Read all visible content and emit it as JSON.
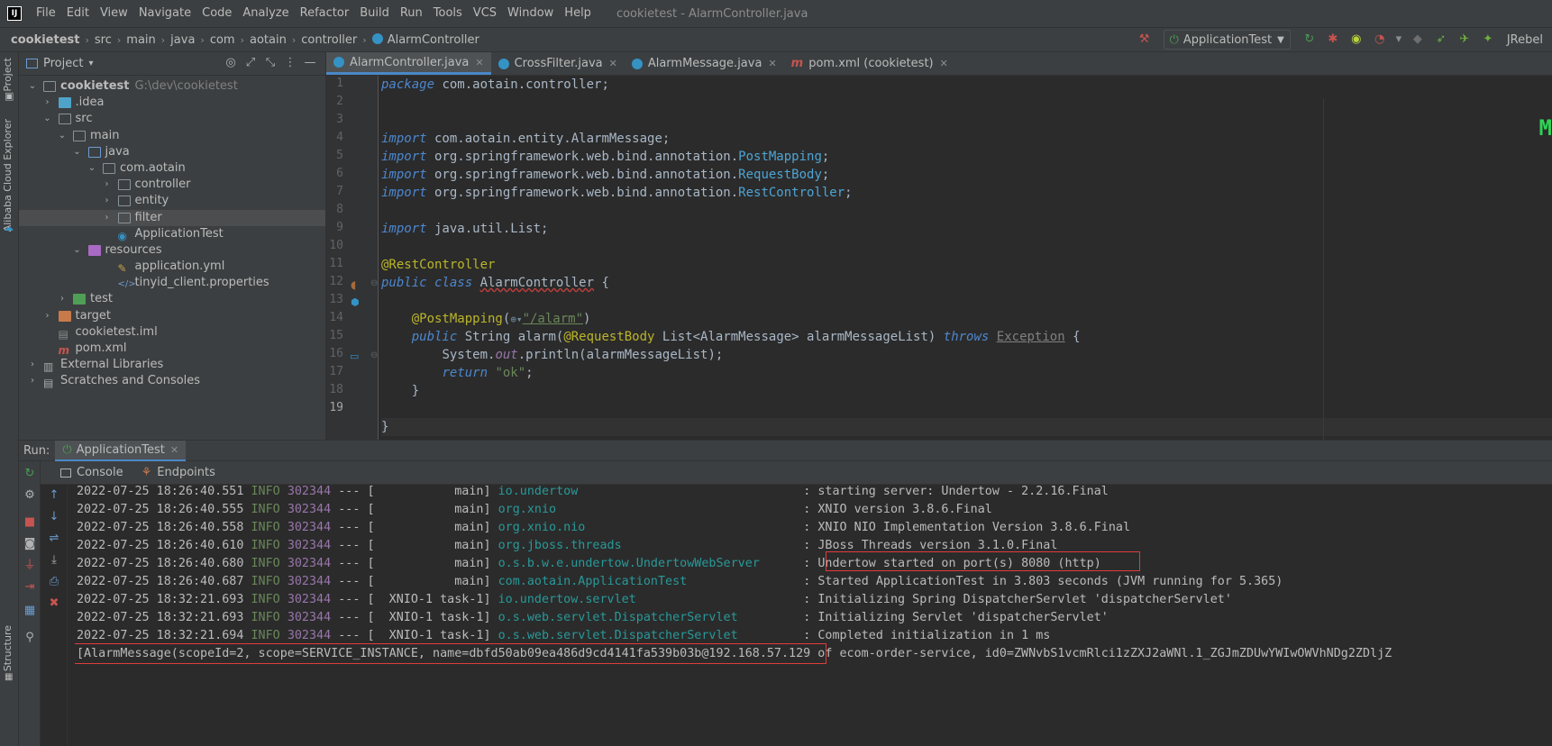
{
  "menu": {
    "items": [
      "File",
      "Edit",
      "View",
      "Navigate",
      "Code",
      "Analyze",
      "Refactor",
      "Build",
      "Run",
      "Tools",
      "VCS",
      "Window",
      "Help"
    ],
    "window_title": "cookietest - AlarmController.java"
  },
  "navbar": {
    "crumbs": [
      "cookietest",
      "src",
      "main",
      "java",
      "com",
      "aotain",
      "controller",
      "AlarmController"
    ],
    "run_config": "ApplicationTest",
    "jrebel": "JRebel"
  },
  "left_strip": {
    "project": "Project",
    "cloud": "Alibaba Cloud Explorer",
    "structure": "Structure"
  },
  "project": {
    "title": "Project",
    "tree": [
      {
        "label": "cookietest",
        "path": "G:\\dev\\cookietest",
        "depth": 0,
        "expanded": true,
        "icon": "folder"
      },
      {
        "label": ".idea",
        "depth": 1,
        "expanded": false,
        "icon": "folder-teal"
      },
      {
        "label": "src",
        "depth": 1,
        "expanded": true,
        "icon": "folder"
      },
      {
        "label": "main",
        "depth": 2,
        "expanded": true,
        "icon": "folder"
      },
      {
        "label": "java",
        "depth": 3,
        "expanded": true,
        "icon": "folder-blue"
      },
      {
        "label": "com.aotain",
        "depth": 4,
        "expanded": true,
        "icon": "folder"
      },
      {
        "label": "controller",
        "depth": 5,
        "expanded": false,
        "icon": "folder"
      },
      {
        "label": "entity",
        "depth": 5,
        "expanded": false,
        "icon": "folder"
      },
      {
        "label": "filter",
        "depth": 5,
        "expanded": false,
        "icon": "folder",
        "selected": true
      },
      {
        "label": "ApplicationTest",
        "depth": 5,
        "icon": "class"
      },
      {
        "label": "resources",
        "depth": 3,
        "expanded": true,
        "icon": "folder-purple"
      },
      {
        "label": "application.yml",
        "depth": 5,
        "icon": "yml"
      },
      {
        "label": "tinyid_client.properties",
        "depth": 5,
        "icon": "props"
      },
      {
        "label": "test",
        "depth": 2,
        "expanded": false,
        "icon": "folder-green"
      },
      {
        "label": "target",
        "depth": 1,
        "expanded": false,
        "icon": "folder-orange"
      },
      {
        "label": "cookietest.iml",
        "depth": 1,
        "icon": "iml"
      },
      {
        "label": "pom.xml",
        "depth": 1,
        "icon": "maven"
      },
      {
        "label": "External Libraries",
        "depth": 0,
        "expanded": false,
        "icon": "libs"
      },
      {
        "label": "Scratches and Consoles",
        "depth": 0,
        "expanded": false,
        "icon": "scratch"
      }
    ]
  },
  "editor": {
    "tabs": [
      {
        "label": "AlarmController.java",
        "active": true
      },
      {
        "label": "CrossFilter.java",
        "active": false
      },
      {
        "label": "AlarmMessage.java",
        "active": false
      },
      {
        "label": "pom.xml (cookietest)",
        "active": false
      }
    ],
    "lines": [
      "1",
      "2",
      "3",
      "4",
      "5",
      "6",
      "7",
      "8",
      "9",
      "10",
      "11",
      "12",
      "13",
      "14",
      "15",
      "16",
      "17",
      "18",
      "19"
    ],
    "code": {
      "l1_kw": "package",
      "l1_rest": " com.aotain.controller;",
      "l4_kw": "import",
      "l4_rest": " com.aotain.entity.AlarmMessage;",
      "l5_kw": "import",
      "l5_pkg": " org.springframework.web.bind.annotation.",
      "l5_cls": "PostMapping",
      "l5_end": ";",
      "l6_kw": "import",
      "l6_pkg": " org.springframework.web.bind.annotation.",
      "l6_cls": "RequestBody",
      "l6_end": ";",
      "l7_kw": "import",
      "l7_pkg": " org.springframework.web.bind.annotation.",
      "l7_cls": "RestController",
      "l7_end": ";",
      "l9_kw": "import",
      "l9_rest": " java.util.List;",
      "l11_ann": "@RestController",
      "l12_kw": "public class ",
      "l12_cls": "AlarmController",
      "l12_end": " {",
      "l14_ann": "@PostMapping",
      "l14_open": "(",
      "l14_str": "\"/alarm\"",
      "l14_close": ")",
      "l15_kw": "public ",
      "l15_a": "String alarm(",
      "l15_ann": "@RequestBody",
      "l15_b": " List<AlarmMessage> alarmMessageList) ",
      "l15_kw2": "throws ",
      "l15_exc": "Exception",
      "l15_end": " {",
      "l16_a": "System.",
      "l16_fld": "out",
      "l16_b": ".println(alarmMessageList);",
      "l17_kw": "return ",
      "l17_str": "\"ok\"",
      "l17_end": ";",
      "l18": "}",
      "l19": "}"
    },
    "deco_text": "M"
  },
  "run": {
    "label": "Run:",
    "tab": "ApplicationTest",
    "subtabs": [
      "Console",
      "Endpoints"
    ],
    "logs": [
      {
        "ts": "2022-07-25 18:26:40.551",
        "lv": "INFO",
        "pid": "302344",
        "sep": "---",
        "thread": "[           main]",
        "logger": "io.undertow                              ",
        "msg": ": starting server: Undertow - 2.2.16.Final"
      },
      {
        "ts": "2022-07-25 18:26:40.555",
        "lv": "INFO",
        "pid": "302344",
        "sep": "---",
        "thread": "[           main]",
        "logger": "org.xnio                                 ",
        "msg": ": XNIO version 3.8.6.Final"
      },
      {
        "ts": "2022-07-25 18:26:40.558",
        "lv": "INFO",
        "pid": "302344",
        "sep": "---",
        "thread": "[           main]",
        "logger": "org.xnio.nio                             ",
        "msg": ": XNIO NIO Implementation Version 3.8.6.Final"
      },
      {
        "ts": "2022-07-25 18:26:40.610",
        "lv": "INFO",
        "pid": "302344",
        "sep": "---",
        "thread": "[           main]",
        "logger": "org.jboss.threads                        ",
        "msg": ": JBoss Threads version 3.1.0.Final"
      },
      {
        "ts": "2022-07-25 18:26:40.680",
        "lv": "INFO",
        "pid": "302344",
        "sep": "---",
        "thread": "[           main]",
        "logger": "o.s.b.w.e.undertow.UndertowWebServer     ",
        "msg": ": Undertow started on port(s) 8080 (http)"
      },
      {
        "ts": "2022-07-25 18:26:40.687",
        "lv": "INFO",
        "pid": "302344",
        "sep": "---",
        "thread": "[           main]",
        "logger": "com.aotain.ApplicationTest               ",
        "msg": ": Started ApplicationTest in 3.803 seconds (JVM running for 5.365)"
      },
      {
        "ts": "2022-07-25 18:32:21.693",
        "lv": "INFO",
        "pid": "302344",
        "sep": "---",
        "thread": "[  XNIO-1 task-1]",
        "logger": "io.undertow.servlet                      ",
        "msg": ": Initializing Spring DispatcherServlet 'dispatcherServlet'"
      },
      {
        "ts": "2022-07-25 18:32:21.693",
        "lv": "INFO",
        "pid": "302344",
        "sep": "---",
        "thread": "[  XNIO-1 task-1]",
        "logger": "o.s.web.servlet.DispatcherServlet        ",
        "msg": ": Initializing Servlet 'dispatcherServlet'"
      },
      {
        "ts": "2022-07-25 18:32:21.694",
        "lv": "INFO",
        "pid": "302344",
        "sep": "---",
        "thread": "[  XNIO-1 task-1]",
        "logger": "o.s.web.servlet.DispatcherServlet        ",
        "msg": ": Completed initialization in 1 ms"
      }
    ],
    "output_line": "[AlarmMessage(scopeId=2, scope=SERVICE_INSTANCE, name=dbfd50ab09ea486d9cd4141fa539b03b@192.168.57.129 of ecom-order-service, id0=ZWNvbS1vcmRlci1zZXJ2aWNl.1_ZGJmZDUwYWIwOWVhNDg2ZDljZ"
  }
}
